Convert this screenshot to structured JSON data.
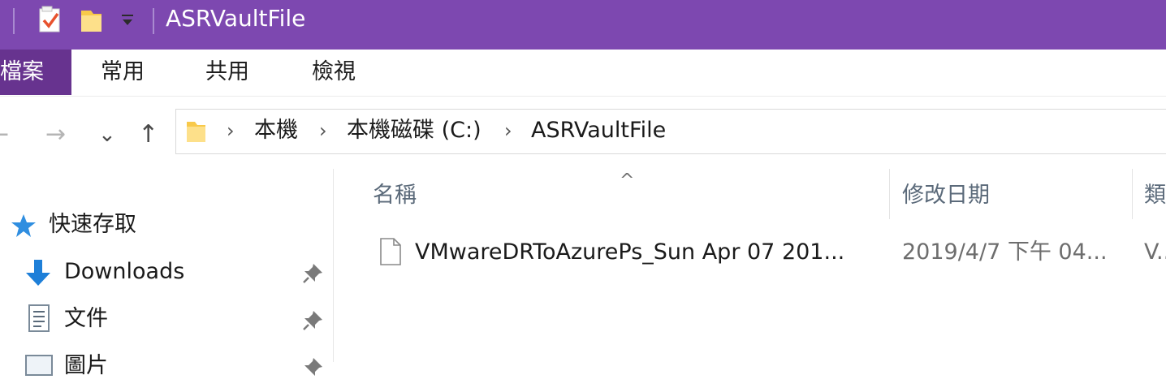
{
  "window": {
    "title": "ASRVaultFile",
    "accent_color": "#7d48b0",
    "quick_access_icons": [
      "properties-checkbox-icon",
      "new-folder-icon",
      "customize-dropdown-icon"
    ]
  },
  "ribbon": {
    "tabs": [
      {
        "label": "檔案",
        "active": true
      },
      {
        "label": "常用"
      },
      {
        "label": "共用"
      },
      {
        "label": "檢視"
      }
    ]
  },
  "navigation": {
    "back": "←",
    "forward": "→",
    "recent": "⌄",
    "up": "↑"
  },
  "address": {
    "crumbs": [
      "本機",
      "本機磁碟 (C:)",
      "ASRVaultFile"
    ],
    "separator": "›"
  },
  "sidebar": {
    "items": [
      {
        "label": "快速存取",
        "icon": "star-icon",
        "pinned": false
      },
      {
        "label": "Downloads",
        "icon": "download-arrow-icon",
        "pinned": true
      },
      {
        "label": "文件",
        "icon": "document-icon",
        "pinned": true
      },
      {
        "label": "圖片",
        "icon": "pictures-icon",
        "pinned": true
      }
    ]
  },
  "file_list": {
    "sort_indicator": "^",
    "columns": [
      "名稱",
      "修改日期",
      "類型"
    ],
    "rows": [
      {
        "name": "VMwareDRToAzurePs_Sun Apr 07 201...",
        "modified": "2019/4/7 下午 04...",
        "type": "V...",
        "icon": "file-icon"
      }
    ]
  }
}
